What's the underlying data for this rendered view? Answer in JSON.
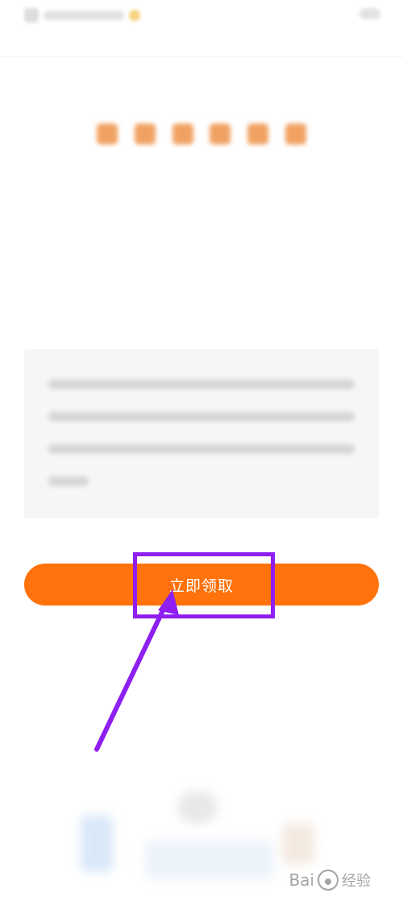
{
  "header": {
    "left_text": "",
    "right_text": ""
  },
  "banner": {
    "title": ""
  },
  "description": {
    "text": ""
  },
  "cta": {
    "label": "立即领取",
    "color": "#ff720c"
  },
  "annotation": {
    "highlight_color": "#8f1ff0",
    "arrow_color": "#8f1ff0"
  },
  "watermark": {
    "brand": "Bai",
    "suffix": "经验",
    "icon": "paw-icon"
  }
}
